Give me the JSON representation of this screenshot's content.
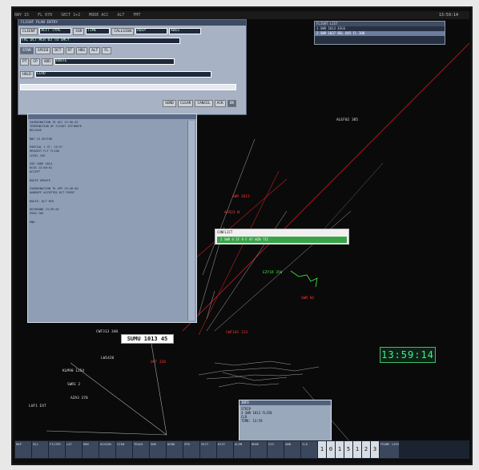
{
  "topbar": {
    "items": [
      "RWY 15",
      "FL 070",
      "SECT 1+2",
      "MODE ACC",
      "ALT",
      "FMT"
    ],
    "clock": "13:59:14"
  },
  "flight_dialog": {
    "title": "FLIGHT PLAN ENTRY",
    "rows": [
      [
        "CLIENT",
        "ACFT TYPE",
        "SSR",
        "TIME",
        "CALLSIGN",
        "ADEP",
        "ADES"
      ],
      [
        "FAL DCT  MCR 03 TO SMCY"
      ],
      [
        "STAR",
        "SPEED",
        "DCT",
        "RT",
        "HDG",
        "ALT",
        "FL"
      ],
      [
        "PT",
        "CP",
        "ADD",
        "ROUTE"
      ],
      [
        "HOLD",
        "CLRD"
      ]
    ],
    "buttons": [
      "SEND",
      "CLEAR",
      "CANCEL",
      "ACK",
      "OK"
    ]
  },
  "coordination": {
    "title": "COORD MESSAGES",
    "lines": [
      "COORDINATION TO ACC 13:56:42",
      "TERMINATION OF FLIGHT ESTIMATE",
      "RELEASE",
      "",
      "RWY 15 SECTOR",
      "",
      "PARTIAL 1 ST: 13:57",
      "REQUEST FLT FL100",
      "LEVEL CHG",
      "",
      "SSR CODE 2014",
      "RCVD 13:58:01",
      "ACCEPT",
      "",
      "ROUTE UPDATE",
      "",
      "COORDINATION TO APP 13:58:40",
      "HANDOFF ACCEPTED DCT POINT",
      "",
      "ROUTE: DCT MCR",
      "",
      "OUTBOUND 13:59:02",
      "FREQ CHG",
      "",
      "END"
    ]
  },
  "flight_list": {
    "header": "FLIGHT LIST",
    "rows": [
      {
        "text": "1 SWR 1813 ESGG",
        "selected": false
      },
      {
        "text": "2 SWR 1837 BSL 045 FL 300",
        "selected": true
      }
    ]
  },
  "conflict": {
    "label": "CONFLICT",
    "text": "2 SWR 4 1F 9 F 97 WIN TIC"
  },
  "qnh": "SUMU 1013 45",
  "clock": "13:59:14",
  "targets": [
    {
      "id": "t1",
      "label": "ALEF02  385",
      "color": "#dddddd"
    },
    {
      "id": "t2",
      "label": "SWR 1813",
      "color": "#ff3333"
    },
    {
      "id": "t3",
      "label": "AFR23  N",
      "color": "#ff4444"
    },
    {
      "id": "t4",
      "label": "EZY1R  350",
      "color": "#44ee44"
    },
    {
      "id": "t5",
      "label": "SWR  N1",
      "color": "#ff3333"
    },
    {
      "id": "t6",
      "label": "CWF313  340",
      "color": "#dddddd"
    },
    {
      "id": "t7",
      "label": "CWF101  313",
      "color": "#ff3333"
    },
    {
      "id": "t8",
      "label": "LW1420",
      "color": "#dddddd"
    },
    {
      "id": "t9",
      "label": "OPF  320",
      "color": "#ff3333"
    },
    {
      "id": "t10",
      "label": "KLM90  1254",
      "color": "#dddddd"
    },
    {
      "id": "t11",
      "label": "SWR1  2",
      "color": "#dddddd"
    },
    {
      "id": "t12",
      "label": "AZA3  370",
      "color": "#dddddd"
    },
    {
      "id": "t13",
      "label": "LUF1  EXT",
      "color": "#dddddd"
    }
  ],
  "mini_panel": {
    "title": "INFO",
    "lines": [
      "STRIP",
      "3 SWR 1813  FL350",
      "CLR",
      "",
      "TIME: 13:59"
    ]
  },
  "bottombar": {
    "cells": [
      "MAP",
      "SEL",
      "FILTER",
      "LAT",
      "RNG",
      "ASSIGN",
      "VIEW",
      "TRACK",
      "GND",
      "WIND",
      "SPD",
      "SECT",
      "HIST",
      "ALRM",
      "MODE",
      "VIS",
      "ANN",
      "CLR"
    ],
    "numbers": [
      "1",
      "0",
      "1",
      "5",
      "1",
      "2",
      "3"
    ],
    "right": "FRAME 11599"
  }
}
